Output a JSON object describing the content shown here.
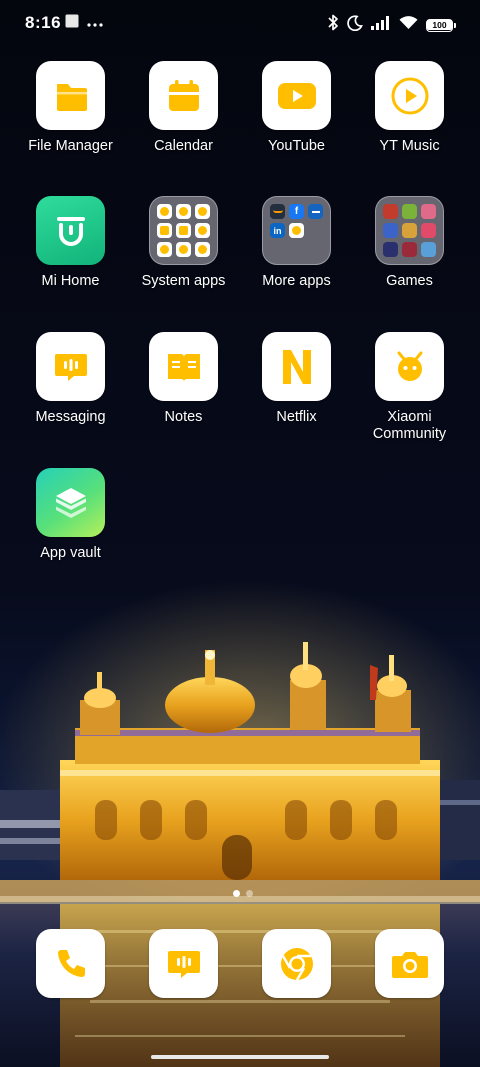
{
  "status_bar": {
    "time": "8:16",
    "left_icons": [
      "notification-square-icon",
      "more-dots-icon"
    ],
    "right_icons": [
      "bluetooth-icon",
      "do-not-disturb-moon-icon",
      "cellular-signal-icon",
      "wifi-icon"
    ],
    "battery": "100"
  },
  "accent_color": "#ffbf00",
  "apps": [
    {
      "label": "File Manager",
      "icon": "folder-icon"
    },
    {
      "label": "Calendar",
      "icon": "calendar-icon"
    },
    {
      "label": "YouTube",
      "icon": "youtube-play-icon"
    },
    {
      "label": "YT Music",
      "icon": "yt-music-icon"
    },
    {
      "label": "Mi Home",
      "icon": "mi-home-icon"
    },
    {
      "label": "System apps",
      "icon": "folder-system-apps"
    },
    {
      "label": "More apps",
      "icon": "folder-more-apps"
    },
    {
      "label": "Games",
      "icon": "folder-games"
    },
    {
      "label": "Messaging",
      "icon": "message-bubble-icon"
    },
    {
      "label": "Notes",
      "icon": "notes-book-icon"
    },
    {
      "label": "Netflix",
      "icon": "netflix-n-icon"
    },
    {
      "label": "Xiaomi Community",
      "icon": "xiaomi-community-icon"
    },
    {
      "label": "App vault",
      "icon": "app-vault-layers-icon"
    }
  ],
  "dock": [
    {
      "icon": "phone-icon"
    },
    {
      "icon": "message-bubble-icon"
    },
    {
      "icon": "chrome-icon"
    },
    {
      "icon": "camera-icon"
    }
  ]
}
